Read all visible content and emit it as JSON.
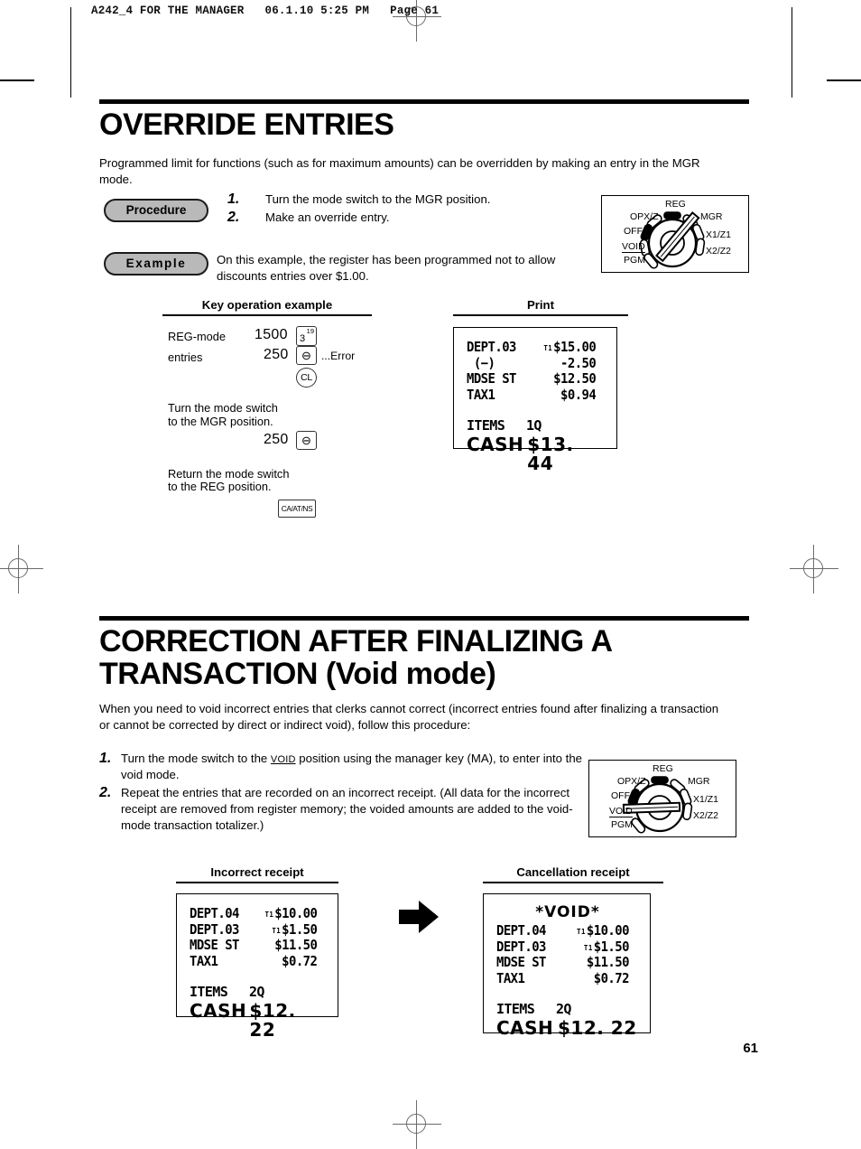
{
  "header": {
    "slug": "A242_4 FOR THE MANAGER   06.1.10 5:25 PM   Page 61"
  },
  "page_number": "61",
  "sections": [
    {
      "id": "override-entries",
      "title": "OVERRIDE ENTRIES",
      "intro": "Programmed limit for functions (such as for maximum amounts) can be overridden by making an entry in the MGR mode.",
      "procedure_badge": "Procedure",
      "example_badge": "Example",
      "steps": [
        {
          "num": "1.",
          "text": "Turn the mode switch to the MGR position."
        },
        {
          "num": "2.",
          "text": "Make an override entry."
        }
      ],
      "example_text": "On this example, the register has been programmed not to allow discounts entries over $1.00.",
      "dial": {
        "labels": {
          "reg": "REG",
          "opxz": "OPX/Z",
          "off": "OFF",
          "void": "VOID",
          "pgm": "PGM",
          "mgr": "MGR",
          "x1z1": "X1/Z1",
          "x2z2": "X2/Z2"
        },
        "selected": "MGR"
      },
      "key_operation": {
        "heading": "Key operation example",
        "row1_label": "REG-mode",
        "row2_label": "entries",
        "amount1": "1500",
        "amount2": "250",
        "error_note": "...Error",
        "key_dept": {
          "main": "3",
          "sup": "19"
        },
        "key_minus": "⊖",
        "key_cl": "CL",
        "key_caat": "CA/AT/NS",
        "note1_line1": "Turn the mode switch",
        "note1_line2": "to the MGR position.",
        "amount3": "250",
        "note2_line1": "Return the mode switch",
        "note2_line2": "to the REG position."
      },
      "print": {
        "heading": "Print",
        "lines": [
          {
            "label": "DEPT.03",
            "flag": "T1",
            "amount": "$15.00"
          },
          {
            "label": " (−)",
            "flag": "",
            "amount": "-2.50"
          },
          {
            "label": "MDSE ST",
            "flag": "",
            "amount": "$12.50"
          },
          {
            "label": "TAX1",
            "flag": "",
            "amount": "$0.94"
          }
        ],
        "items_label": "ITEMS",
        "items_count": "1Q",
        "total_label": "CASH",
        "total_amount": "$13. 44"
      }
    },
    {
      "id": "correction-after-finalizing",
      "title_line1": "CORRECTION AFTER FINALIZING A",
      "title_line2": "TRANSACTION  (Void mode)",
      "intro": "When you need to void incorrect entries that clerks cannot correct (incorrect entries found after finalizing a transaction or cannot be corrected by direct or indirect void), follow this procedure:",
      "steps": [
        {
          "num": "1.",
          "text_before": "Turn the mode switch to the ",
          "highlight": "VOID",
          "text_after": " position using the manager key (MA), to enter into the void mode."
        },
        {
          "num": "2.",
          "text_before": "Repeat the entries that are recorded on an incorrect receipt.  (All data for the incorrect receipt are removed from register memory; the voided amounts are added to the void-mode transaction totalizer.)",
          "highlight": "",
          "text_after": ""
        }
      ],
      "dial": {
        "labels": {
          "reg": "REG",
          "opxz": "OPX/Z",
          "off": "OFF",
          "void": "VOID",
          "pgm": "PGM",
          "mgr": "MGR",
          "x1z1": "X1/Z1",
          "x2z2": "X2/Z2"
        },
        "selected": "VOID"
      },
      "incorrect_receipt": {
        "heading": "Incorrect receipt",
        "void_header": "",
        "lines": [
          {
            "label": "DEPT.04",
            "flag": "T1",
            "amount": "$10.00"
          },
          {
            "label": "DEPT.03",
            "flag": "T1",
            "amount": "$1.50"
          },
          {
            "label": "MDSE ST",
            "flag": "",
            "amount": "$11.50"
          },
          {
            "label": "TAX1",
            "flag": "",
            "amount": "$0.72"
          }
        ],
        "items_label": "ITEMS",
        "items_count": "2Q",
        "total_label": "CASH",
        "total_amount": "$12. 22"
      },
      "cancellation_receipt": {
        "heading": "Cancellation receipt",
        "void_header": "*VOID*",
        "lines": [
          {
            "label": "DEPT.04",
            "flag": "T1",
            "amount": "$10.00"
          },
          {
            "label": "DEPT.03",
            "flag": "T1",
            "amount": "$1.50"
          },
          {
            "label": "MDSE ST",
            "flag": "",
            "amount": "$11.50"
          },
          {
            "label": "TAX1",
            "flag": "",
            "amount": "$0.72"
          }
        ],
        "items_label": "ITEMS",
        "items_count": "2Q",
        "total_label": "CASH",
        "total_amount": "$12. 22"
      },
      "arrow_icon": "arrow-right-icon"
    }
  ]
}
